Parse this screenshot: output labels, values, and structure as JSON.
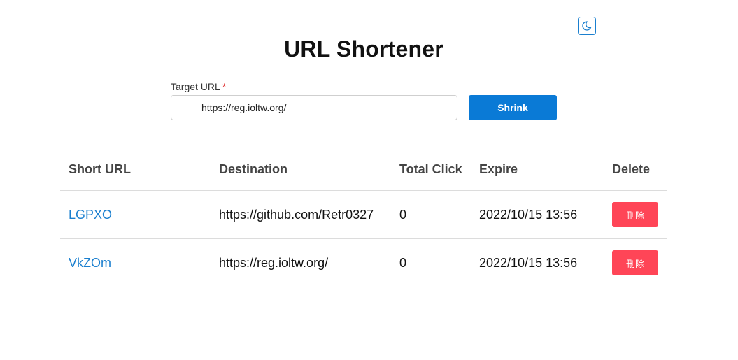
{
  "header": {
    "title": "URL Shortener",
    "theme_toggle_icon": "moon-icon",
    "accent_color": "#1a7fcf"
  },
  "form": {
    "label": "Target URL",
    "required_mark": "*",
    "input_value": "https://reg.ioltw.org/",
    "submit_label": "Shrink",
    "submit_color": "#0a7ad6"
  },
  "table": {
    "headers": [
      "Short URL",
      "Destination",
      "Total Click",
      "Expire",
      "Delete"
    ],
    "delete_color": "#ff4557",
    "rows": [
      {
        "short": "LGPXO",
        "destination": "https://github.com/Retr0327",
        "clicks": "0",
        "expire": "2022/10/15 13:56",
        "delete_label": "刪除"
      },
      {
        "short": "VkZOm",
        "destination": "https://reg.ioltw.org/",
        "clicks": "0",
        "expire": "2022/10/15 13:56",
        "delete_label": "刪除"
      }
    ]
  }
}
